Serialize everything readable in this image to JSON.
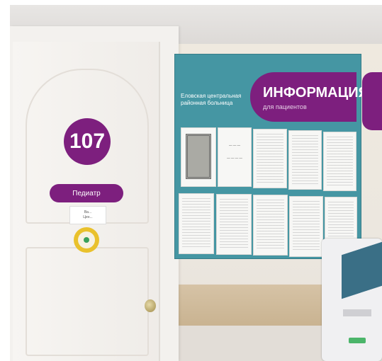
{
  "door": {
    "room_number": "107",
    "role_label": "Педиатр",
    "note_lines": [
      "Ва...",
      "Цен..."
    ]
  },
  "board": {
    "org_name": "Еловская центральная районная больница",
    "banner_title": "ИНФОРМАЦИЯ",
    "banner_subtitle": "для пациентов"
  },
  "colors": {
    "accent_magenta": "#7d1f7e",
    "board_teal": "#4596a3",
    "sticker_yellow": "#e9c12c"
  }
}
